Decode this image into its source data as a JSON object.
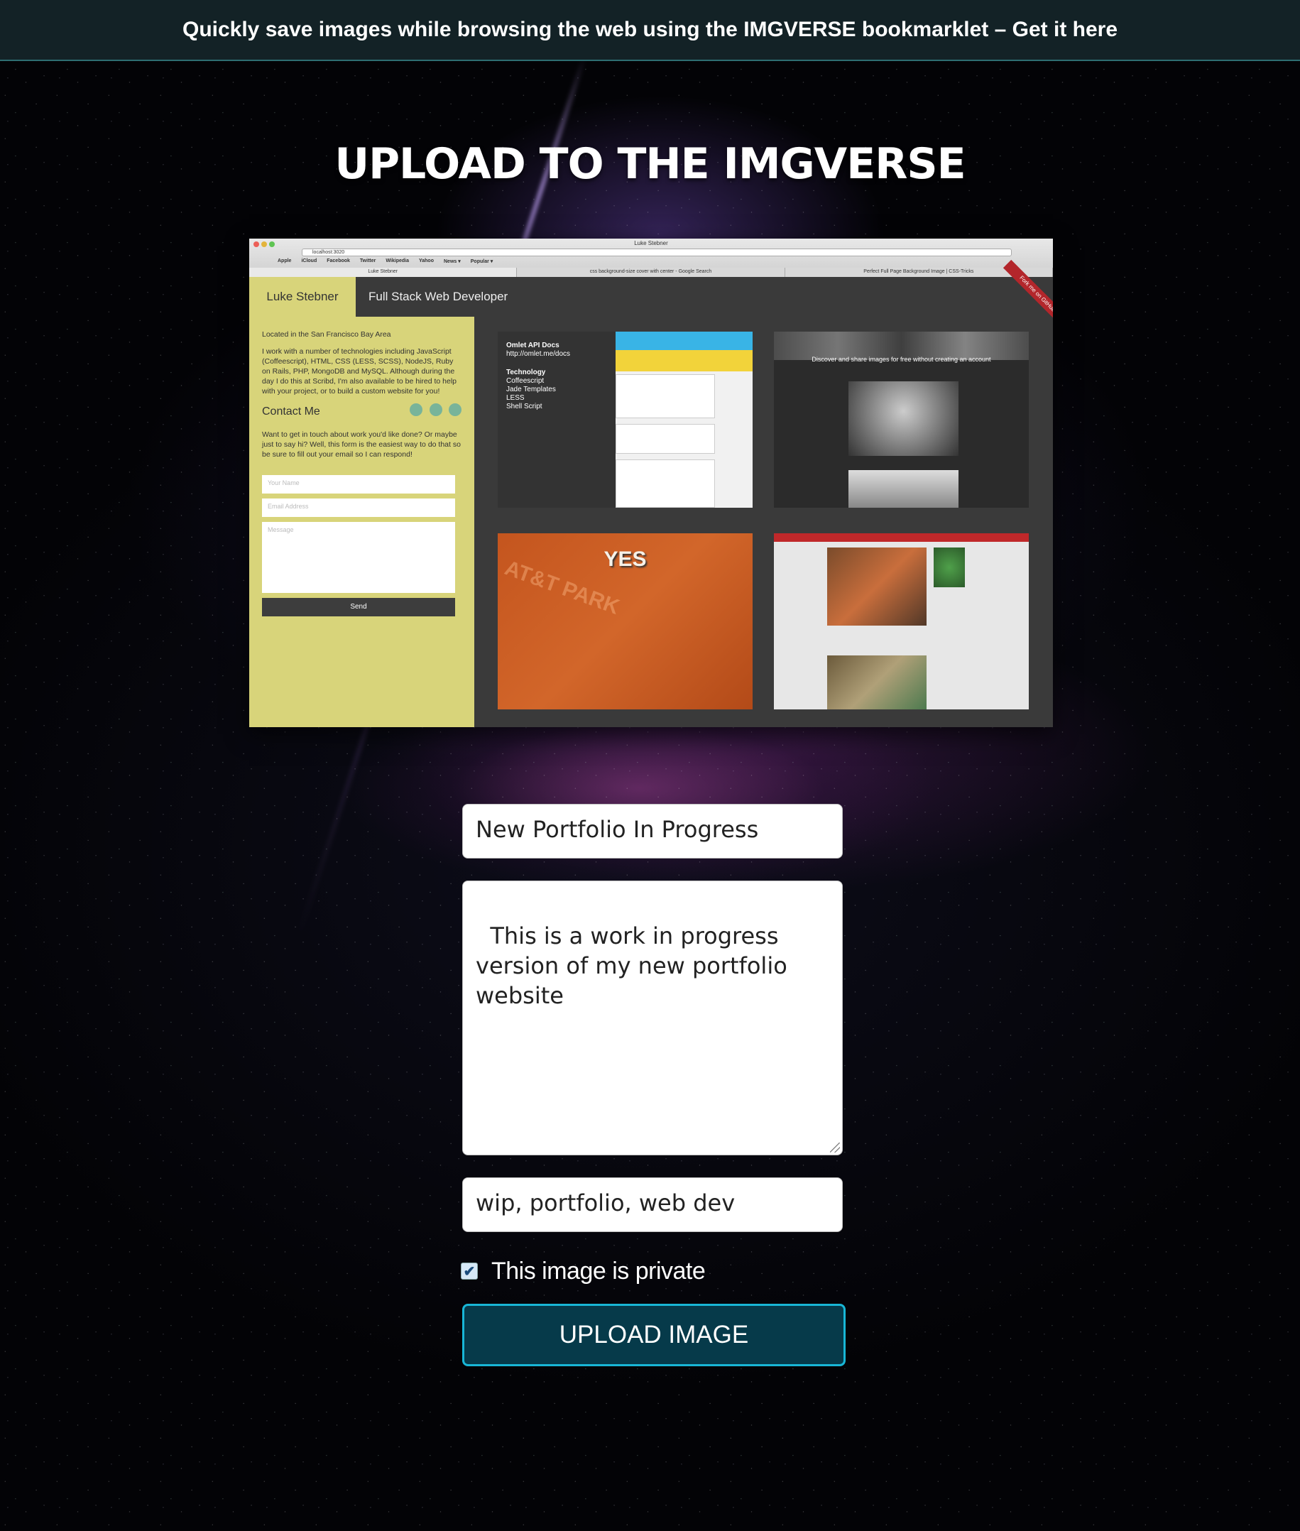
{
  "banner": {
    "text": "Quickly save images while browsing the web using the IMGVERSE bookmarklet – Get it here"
  },
  "page": {
    "title": "UPLOAD TO THE IMGVERSE"
  },
  "preview": {
    "browser_title": "Luke Stebner",
    "url": "localhost:3020",
    "bookmarks": [
      "Apple",
      "iCloud",
      "Facebook",
      "Twitter",
      "Wikipedia",
      "Yahoo",
      "News ▾",
      "Popular ▾"
    ],
    "tabs": [
      "Luke Stebner",
      "css background-size cover with center - Google Search",
      "Perfect Full Page Background Image | CSS-Tricks"
    ],
    "site_name": "Luke Stebner",
    "site_role": "Full Stack Web Developer",
    "ribbon": "Fork me on GitHub",
    "location": "Located in the San Francisco Bay Area",
    "bio": "I work with a number of technologies including JavaScript (Coffeescript), HTML, CSS (LESS, SCSS), NodeJS, Ruby on Rails, PHP, MongoDB and MySQL. Although during the day I do this at Scribd, I'm also available to be hired to help with your project, or to build a custom website for you!",
    "contact_heading": "Contact Me",
    "contact_text": "Want to get in touch about work you'd like done? Or maybe just to say hi? Well, this form is the easiest way to do that so be sure to fill out your email so I can respond!",
    "name_placeholder": "Your Name",
    "email_placeholder": "Email Address",
    "message_placeholder": "Message",
    "send_label": "Send",
    "thumb1_title": "Omlet API Docs",
    "thumb1_url": "http://omlet.me/docs",
    "thumb1_list": [
      "Technology",
      "Coffeescript",
      "Jade Templates",
      "LESS",
      "Shell Script"
    ],
    "thumb2_caption": "Discover and share images for free without creating an account",
    "thumb3_text": "YES",
    "thumb3_bg_text": "AT&T PARK"
  },
  "form": {
    "title_value": "New Portfolio In Progress",
    "description_value": "This is a work in progress\nversion of my new portfolio\nwebsite",
    "tags_value": "wip, portfolio, web dev",
    "private_checked": true,
    "private_label": "This image is private",
    "upload_label": "UPLOAD IMAGE"
  },
  "colors": {
    "banner_bg": "#132226",
    "button_bg": "#063a4a",
    "button_border": "#18b6d6",
    "panel_yellow": "#d8d47a"
  }
}
